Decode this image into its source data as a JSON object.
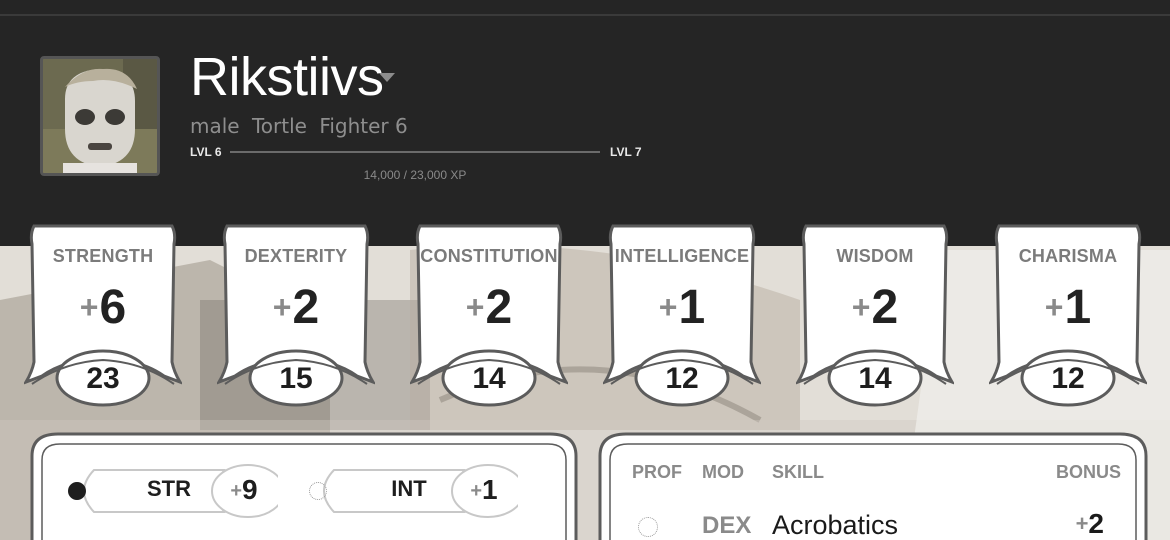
{
  "character": {
    "name": "Rikstiivs",
    "gender": "male",
    "race": "Tortle",
    "class_level": "Fighter 6"
  },
  "xp": {
    "level_current": "LVL 6",
    "level_next": "LVL 7",
    "text": "14,000 / 23,000 XP",
    "progress_fraction": 0.0
  },
  "abilities": [
    {
      "name": "STRENGTH",
      "sign": "+",
      "mod": "6",
      "score": "23"
    },
    {
      "name": "DEXTERITY",
      "sign": "+",
      "mod": "2",
      "score": "15"
    },
    {
      "name": "CONSTITUTION",
      "sign": "+",
      "mod": "2",
      "score": "14"
    },
    {
      "name": "INTELLIGENCE",
      "sign": "+",
      "mod": "1",
      "score": "12"
    },
    {
      "name": "WISDOM",
      "sign": "+",
      "mod": "2",
      "score": "14"
    },
    {
      "name": "CHARISMA",
      "sign": "+",
      "mod": "1",
      "score": "12"
    }
  ],
  "saving_throws": [
    {
      "abbr": "STR",
      "proficient": true,
      "sign": "+",
      "bonus": "9"
    },
    {
      "abbr": "INT",
      "proficient": false,
      "sign": "+",
      "bonus": "1"
    }
  ],
  "skills": {
    "headers": {
      "prof": "PROF",
      "mod": "MOD",
      "skill": "SKILL",
      "bonus": "BONUS"
    },
    "rows": [
      {
        "proficient": false,
        "mod": "DEX",
        "name": "Acrobatics",
        "sign": "+",
        "bonus": "2"
      }
    ]
  },
  "colors": {
    "header_bg": "#252525",
    "card_border": "#5c5c5c",
    "text_dark": "#1e1e1e",
    "text_muted": "#8a8a8a"
  },
  "icons": {
    "name_dropdown": "caret-down-icon",
    "proficiency": "proficiency-dot-icon"
  }
}
